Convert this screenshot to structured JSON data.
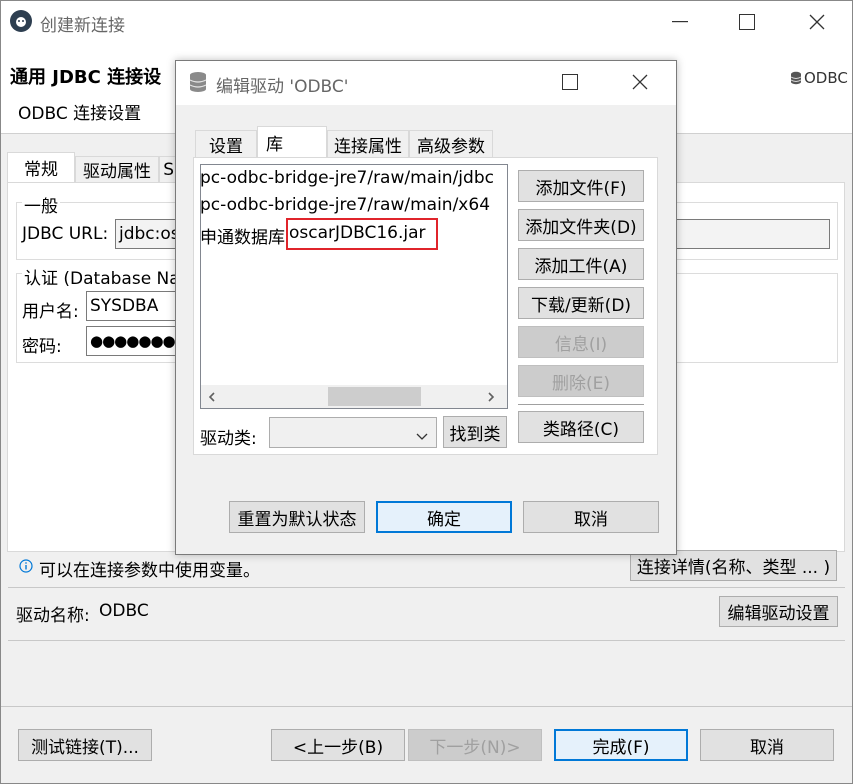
{
  "main_window": {
    "title": "创建新连接",
    "header_title": "通用 JDBC 连接设",
    "header_subtitle": "ODBC 连接设置",
    "brand": "ODBC",
    "tabs": [
      "常规",
      "驱动属性",
      "SS"
    ],
    "general_group": "一般",
    "jdbc_url_label": "JDBC URL:",
    "jdbc_url_value": "jdbc:os",
    "auth_group": "认证 (Database Na",
    "username_label": "用户名:",
    "username_value": "SYSDBA",
    "password_label": "密码:",
    "password_value": "●●●●●●●",
    "info_text": "可以在连接参数中使用变量。",
    "connection_details_button": "连接详情(名称、类型 ... )",
    "driver_name_label": "驱动名称:",
    "driver_name_value": "ODBC",
    "edit_driver_button": "编辑驱动设置",
    "test_button": "测试链接(T)...",
    "back_button": "<上一步(B)",
    "next_button": "下一步(N)>",
    "finish_button": "完成(F)",
    "cancel_button": "取消"
  },
  "dialog": {
    "title": "编辑驱动 'ODBC'",
    "tabs": [
      "设置",
      "库",
      "连接属性",
      "高级参数"
    ],
    "libraries": [
      "pc-odbc-bridge-jre7/raw/main/jdbc",
      "pc-odbc-bridge-jre7/raw/main/x64",
      "申通数据库"
    ],
    "highlighted_file": "oscarJDBC16.jar",
    "driver_class_label": "驱动类:",
    "find_class_button": "找到类",
    "add_file_button": "添加文件(F)",
    "add_folder_button": "添加文件夹(D)",
    "add_artifact_button": "添加工件(A)",
    "download_button": "下载/更新(D)",
    "info_button": "信息(I)",
    "delete_button": "删除(E)",
    "classpath_button": "类路径(C)",
    "reset_button": "重置为默认状态",
    "ok_button": "确定",
    "cancel_button": "取消"
  },
  "colors": {
    "accent": "#0078d7",
    "highlight_border": "#e0242b",
    "window_bg": "#f0f0f0"
  }
}
